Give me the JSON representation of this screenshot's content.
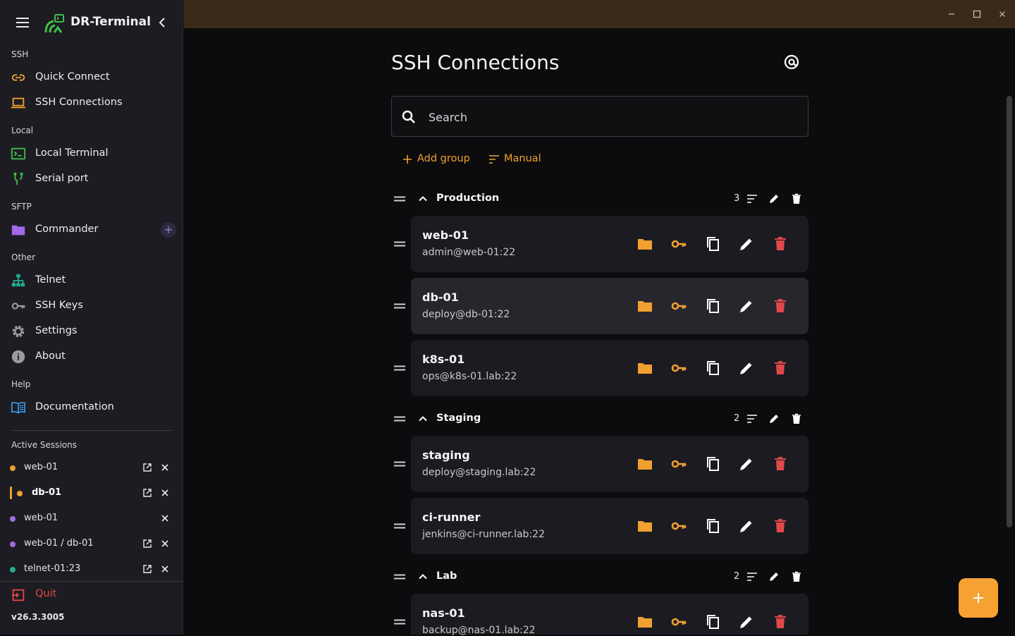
{
  "app": {
    "name": "DR-Terminal",
    "version": "v26.3.3005"
  },
  "sidebar": {
    "sections": [
      {
        "label": "SSH",
        "items": [
          {
            "label": "Quick Connect",
            "icon": "link-icon"
          },
          {
            "label": "SSH Connections",
            "icon": "laptop-icon"
          }
        ]
      },
      {
        "label": "Local",
        "items": [
          {
            "label": "Local Terminal",
            "icon": "terminal-icon"
          },
          {
            "label": "Serial port",
            "icon": "serial-port-icon"
          }
        ]
      },
      {
        "label": "SFTP",
        "items": [
          {
            "label": "Commander",
            "icon": "folder-icon"
          }
        ]
      },
      {
        "label": "Other",
        "items": [
          {
            "label": "Telnet",
            "icon": "network-icon"
          },
          {
            "label": "SSH Keys",
            "icon": "key-icon"
          },
          {
            "label": "Settings",
            "icon": "gear-icon"
          },
          {
            "label": "About",
            "icon": "info-icon"
          }
        ]
      },
      {
        "label": "Help",
        "items": [
          {
            "label": "Documentation",
            "icon": "book-icon"
          }
        ]
      }
    ],
    "active_sessions_label": "Active Sessions",
    "sessions": [
      {
        "name": "web-01",
        "color": "#f0a030"
      },
      {
        "name": "db-01",
        "color": "#f0a030"
      },
      {
        "name": "web-01",
        "color": "#a070e0"
      },
      {
        "name": "web-01 / db-01",
        "color": "#a070e0"
      },
      {
        "name": "telnet-01:23",
        "color": "#20b090"
      }
    ],
    "quit_label": "Quit"
  },
  "main": {
    "title": "SSH Connections",
    "search_placeholder": "Search",
    "add_group_label": "Add group",
    "sort_label": "Manual",
    "groups": [
      {
        "name": "Production",
        "count": "3",
        "connections": [
          {
            "name": "web-01",
            "host": "admin@web-01:22"
          },
          {
            "name": "db-01",
            "host": "deploy@db-01:22"
          },
          {
            "name": "k8s-01",
            "host": "ops@k8s-01.lab:22"
          }
        ]
      },
      {
        "name": "Staging",
        "count": "2",
        "connections": [
          {
            "name": "staging",
            "host": "deploy@staging.lab:22"
          },
          {
            "name": "ci-runner",
            "host": "jenkins@ci-runner.lab:22"
          }
        ]
      },
      {
        "name": "Lab",
        "count": "2",
        "connections": [
          {
            "name": "nas-01",
            "host": "backup@nas-01.lab:22"
          }
        ]
      }
    ]
  },
  "colors": {
    "accent": "#f0a030",
    "danger": "#e0484a",
    "sidebar_bg": "#1d1c22",
    "titlebar": "#3a2a18"
  }
}
